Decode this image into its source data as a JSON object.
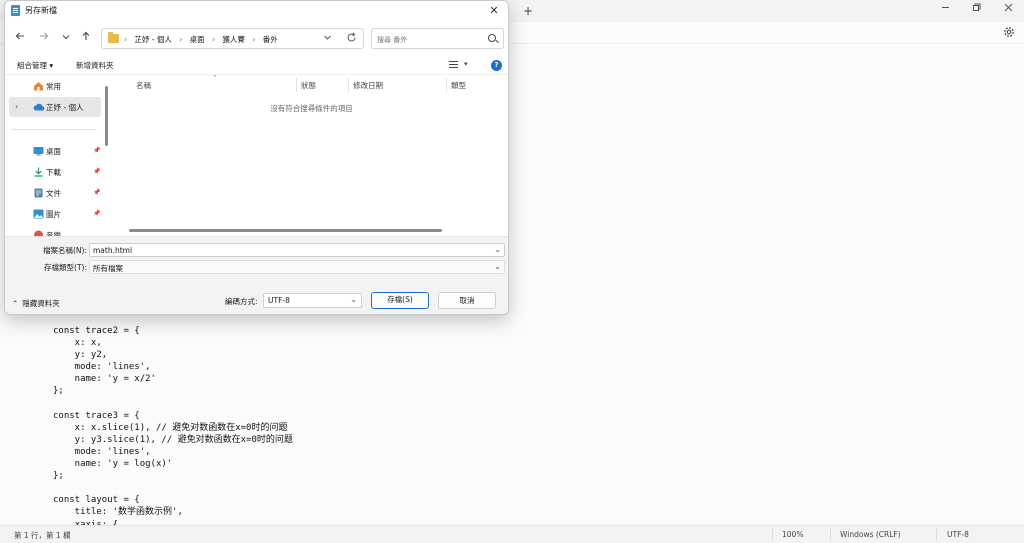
{
  "notepad": {
    "new_tab_symbol": "+",
    "code_lines": [
      "const trace2 = {",
      "    x: x,",
      "    y: y2,",
      "    mode: 'lines',",
      "    name: 'y = x/2'",
      "};",
      "",
      "const trace3 = {",
      "    x: x.slice(1), // 避免对数函数在x=0时的问题",
      "    y: y3.slice(1), // 避免对数函数在x=0时的问题",
      "    mode: 'lines',",
      "    name: 'y = log(x)'",
      "};",
      "",
      "const layout = {",
      "    title: '数学函数示例',",
      "    xaxis: {"
    ],
    "status": {
      "position": "第 1 行，第 1 欄",
      "zoom": "100%",
      "line_ending": "Windows (CRLF)",
      "encoding": "UTF-8"
    }
  },
  "dialog": {
    "title": "另存新檔",
    "close_symbol": "✕",
    "breadcrumb": [
      "芷妤 - 個人",
      "桌面",
      "獲人賽",
      "番外"
    ],
    "search_placeholder": "搜尋 番外",
    "toolbar": {
      "organize": "組合管理 ▾",
      "new_folder": "新增資料夾",
      "help": "?"
    },
    "sidebar": {
      "items": [
        {
          "label": "常用",
          "icon": "home-icon",
          "color": "#e8833a"
        },
        {
          "label": "芷妤 - 個人",
          "icon": "onedrive-cloud-icon",
          "color": "#2b7cd3"
        },
        {
          "label": "桌面",
          "icon": "desktop-icon",
          "color": "#2f8fd8"
        },
        {
          "label": "下載",
          "icon": "download-icon",
          "color": "#1f9a6b"
        },
        {
          "label": "文件",
          "icon": "documents-icon",
          "color": "#5b7fa6"
        },
        {
          "label": "圖片",
          "icon": "pictures-icon",
          "color": "#2f8fd8"
        },
        {
          "label": "音樂",
          "icon": "music-icon",
          "color": "#e0563b"
        }
      ]
    },
    "columns": [
      "名稱",
      "狀態",
      "修改日期",
      "類型"
    ],
    "empty_message": "沒有符合搜尋條件的項目",
    "filename_label": "檔案名稱(N):",
    "filename_value": "math.html",
    "filetype_label": "存檔類型(T):",
    "filetype_value": "所有檔案",
    "hide_folders": "隱藏資料夾",
    "encoding_label": "編碼方式:",
    "encoding_value": "UTF-8",
    "save_button": "存檔(S)",
    "cancel_button": "取消"
  }
}
